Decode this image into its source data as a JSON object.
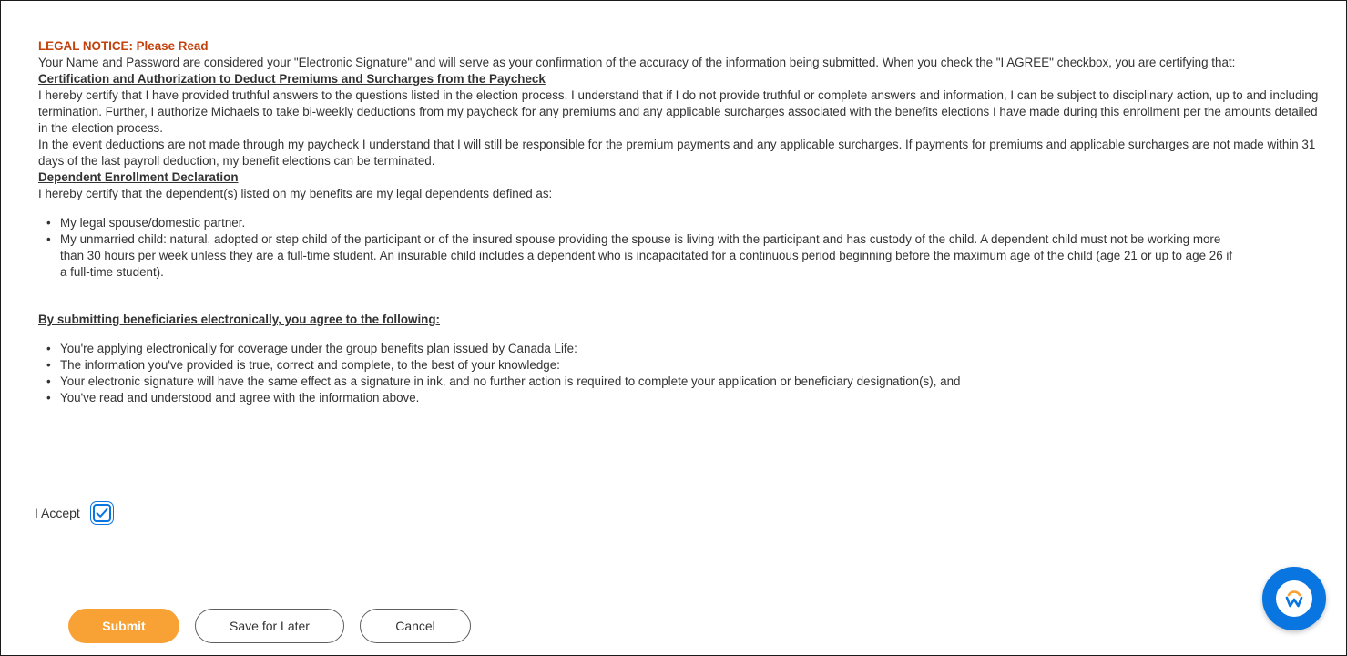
{
  "legal": {
    "title": "LEGAL NOTICE: Please Read",
    "intro": "Your Name and Password are considered your \"Electronic Signature\" and will serve as your confirmation of the accuracy of the information being submitted. When you check the \"I AGREE\" checkbox, you are certifying that:",
    "cert_heading": "Certification and Authorization to Deduct Premiums and Surcharges from the Paycheck",
    "cert_para1": "I hereby certify that I have provided truthful answers to the questions listed in the election process. I understand that if I do not provide truthful or complete answers and information, I can be subject to disciplinary action, up to and including termination. Further, I authorize Michaels to take bi-weekly deductions from my paycheck for any premiums and any applicable surcharges associated with the benefits elections I have made during this enrollment per the amounts detailed in the election process.",
    "cert_para2": "In the event deductions are not made through my paycheck I understand that I will still be responsible for the premium payments and any applicable surcharges. If payments for premiums and applicable surcharges are not made within 31 days of the last payroll deduction, my benefit elections can be terminated.",
    "dep_heading": "Dependent Enrollment Declaration",
    "dep_intro": "I hereby certify that the dependent(s) listed on my benefits are my legal dependents defined as:",
    "dep_items": [
      "My legal spouse/domestic partner.",
      "My unmarried child: natural, adopted or step child of the participant or of the insured spouse providing the spouse is living with the participant and has custody of the child.  A dependent child must not be working more than 30 hours per week unless they are a full-time student.  An insurable child includes a dependent who is incapacitated for a continuous period beginning before the maximum age of the child (age 21 or up to age 26 if a full-time student)."
    ],
    "benef_heading": "By submitting beneficiaries electronically, you agree to the following:",
    "benef_items": [
      "You're applying electronically for coverage under the group benefits plan issued by Canada Life:",
      "The information you've provided is true, correct and complete, to the best of your knowledge:",
      "Your electronic signature will have the same effect as a signature in ink, and no further action is required to complete your application or beneficiary designation(s), and",
      "You've read and understood and agree with the information above."
    ]
  },
  "accept": {
    "label": "I Accept",
    "checked": true
  },
  "actions": {
    "submit_label": "Submit",
    "save_label": "Save for Later",
    "cancel_label": "Cancel"
  },
  "help": {
    "icon": "workday-help-icon"
  },
  "colors": {
    "title_orange": "#c2410c",
    "primary_button": "#f8a134",
    "accent_blue": "#0875e1",
    "text": "#333333"
  }
}
